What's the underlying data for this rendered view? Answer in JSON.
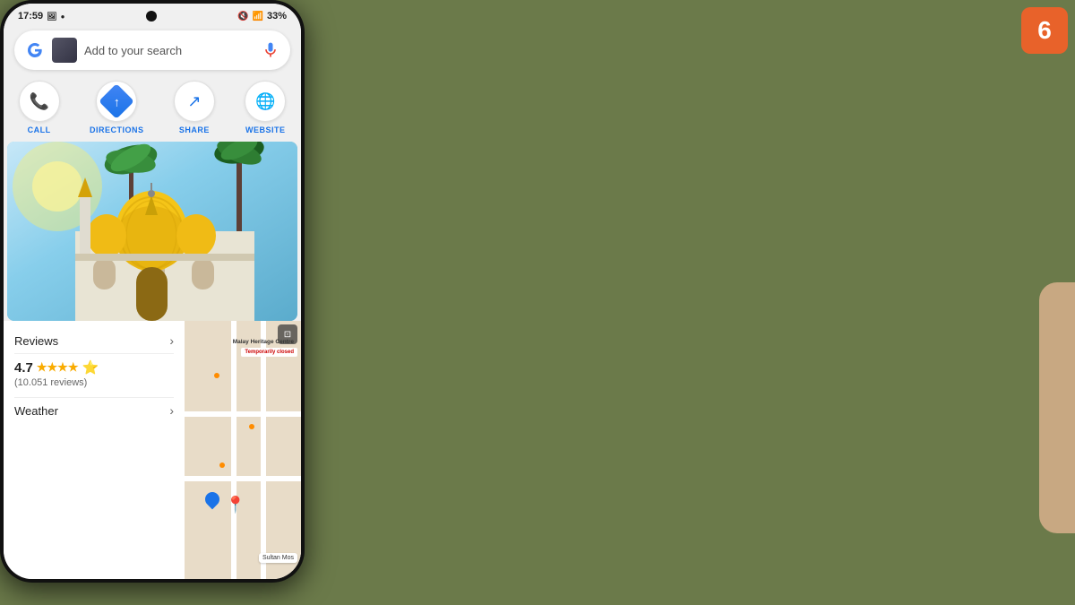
{
  "channel_badge": "6",
  "status_bar": {
    "time": "17:59",
    "battery": "33%",
    "signal": "●●●",
    "wifi": "wifi"
  },
  "search": {
    "placeholder": "Add to your search",
    "aria": "Google search bar"
  },
  "actions": {
    "call": "CALL",
    "directions": "DIRECTIONS",
    "share": "SHARE",
    "website": "WEBSITE"
  },
  "reviews": {
    "label": "Reviews",
    "rating": "4.7",
    "stars_full": 4,
    "stars_half": true,
    "count": "(10.051 reviews)"
  },
  "weather": {
    "label": "Weather"
  },
  "map": {
    "location_name": "Sultan Mos",
    "nearby": "Malay Heritage Centre",
    "status": "Temporarily closed"
  }
}
